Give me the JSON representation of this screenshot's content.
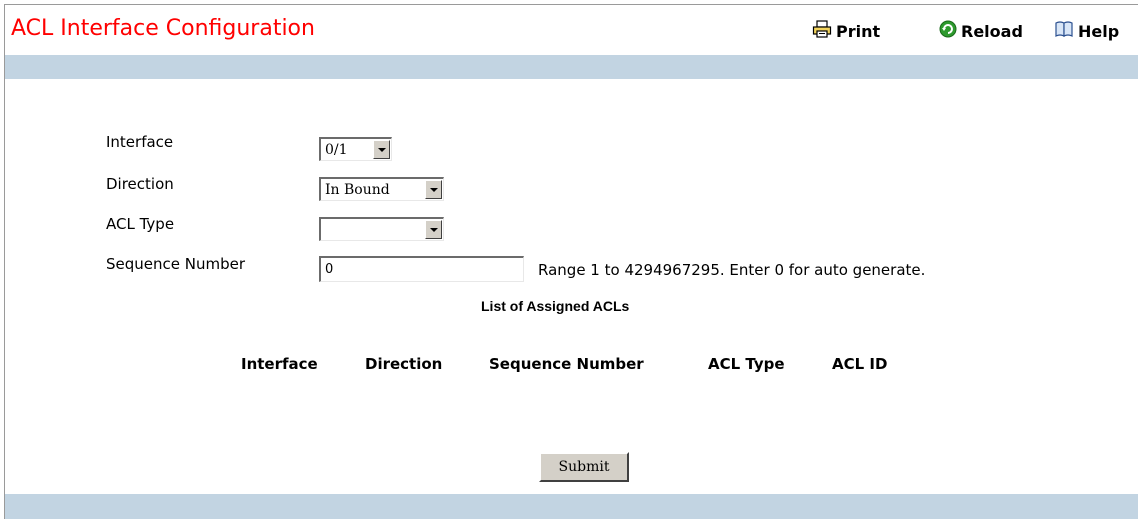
{
  "page": {
    "title": "ACL Interface Configuration"
  },
  "toolbar": {
    "print_label": "Print",
    "reload_label": "Reload",
    "help_label": "Help"
  },
  "form": {
    "interface": {
      "label": "Interface",
      "value": "0/1"
    },
    "direction": {
      "label": "Direction",
      "value": "In Bound"
    },
    "acl_type": {
      "label": "ACL Type",
      "value": ""
    },
    "sequence": {
      "label": "Sequence Number",
      "value": "0",
      "hint": "Range 1 to 4294967295. Enter 0 for auto generate."
    }
  },
  "list": {
    "title": "List of Assigned ACLs",
    "columns": [
      "Interface",
      "Direction",
      "Sequence Number",
      "ACL Type",
      "ACL ID"
    ],
    "rows": []
  },
  "actions": {
    "submit_label": "Submit"
  },
  "colors": {
    "title": "#ff0000",
    "bar": "#c2d4e2",
    "reload_icon": "#2e9a2e"
  },
  "icons": {
    "print": "printer-icon",
    "reload": "reload-icon",
    "help": "help-book-icon"
  }
}
